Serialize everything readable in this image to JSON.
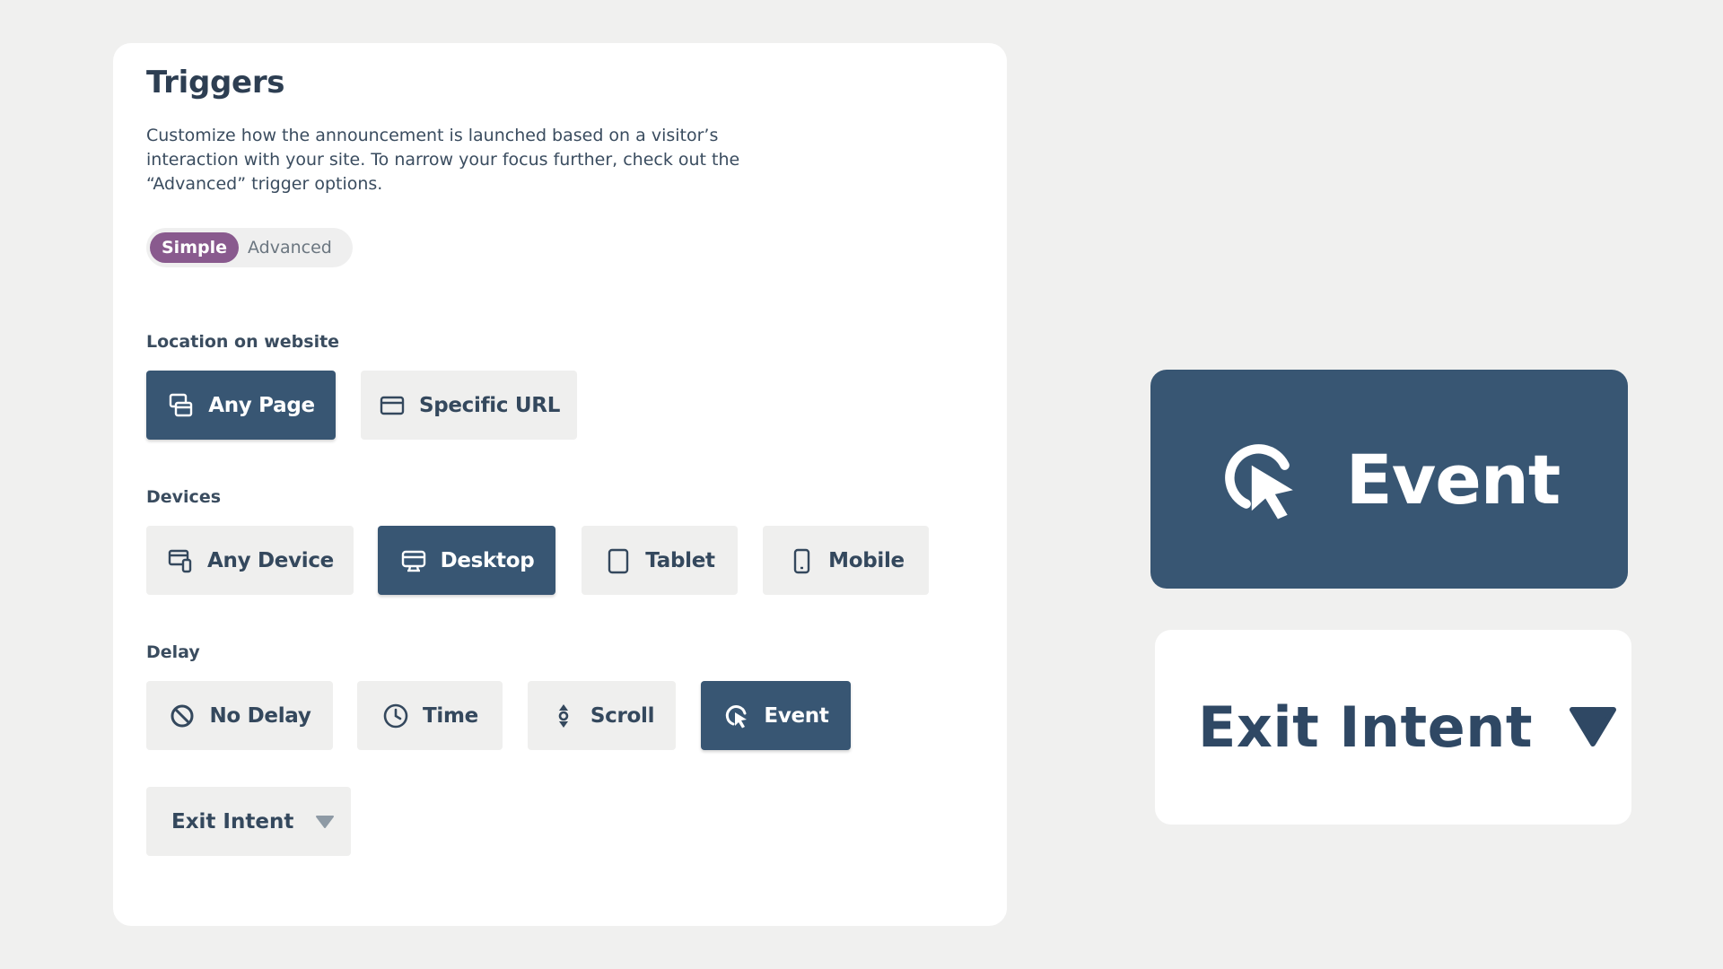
{
  "panel": {
    "title": "Triggers",
    "description": "Customize how the announcement is launched based on a visitor’s interaction with your site. To narrow your focus further, check out the “Advanced” trigger options.",
    "mode_toggle": {
      "active": "Simple",
      "inactive": "Advanced"
    }
  },
  "location": {
    "label": "Location on website",
    "options": [
      {
        "label": "Any Page",
        "icon": "pages-icon",
        "selected": true
      },
      {
        "label": "Specific URL",
        "icon": "url-card-icon",
        "selected": false
      }
    ]
  },
  "devices": {
    "label": "Devices",
    "options": [
      {
        "label": "Any Device",
        "icon": "any-device-icon",
        "selected": false
      },
      {
        "label": "Desktop",
        "icon": "desktop-icon",
        "selected": true
      },
      {
        "label": "Tablet",
        "icon": "tablet-icon",
        "selected": false
      },
      {
        "label": "Mobile",
        "icon": "mobile-icon",
        "selected": false
      }
    ]
  },
  "delay": {
    "label": "Delay",
    "options": [
      {
        "label": "No Delay",
        "icon": "no-delay-icon",
        "selected": false
      },
      {
        "label": "Time",
        "icon": "clock-icon",
        "selected": false
      },
      {
        "label": "Scroll",
        "icon": "scroll-icon",
        "selected": false
      },
      {
        "label": "Event",
        "icon": "click-pointer-icon",
        "selected": true
      }
    ],
    "event_dropdown": {
      "value": "Exit Intent",
      "icon": "caret-down-icon"
    }
  },
  "zoom": {
    "event_button": {
      "label": "Event",
      "icon": "click-pointer-icon"
    },
    "dropdown": {
      "value": "Exit Intent",
      "icon": "caret-down-icon"
    }
  },
  "colors": {
    "background": "#f0f0ef",
    "selected": "#385673",
    "unselected": "#efefee",
    "toggle_active": "#895a8e",
    "text": "#2d3e52"
  }
}
